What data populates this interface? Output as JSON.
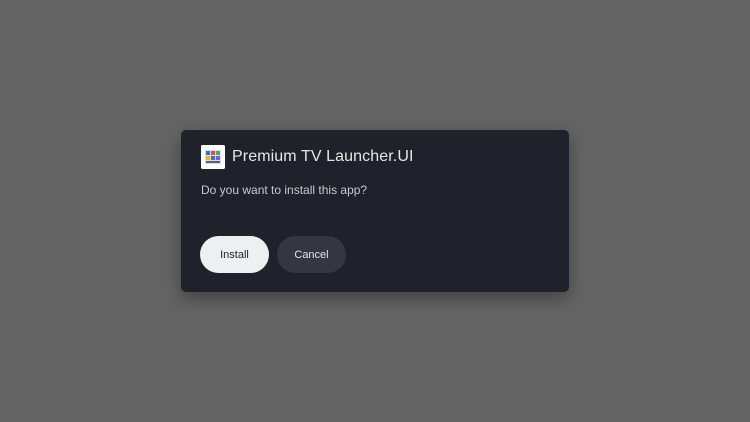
{
  "dialog": {
    "app_icon": "launcher-app-icon",
    "title": "Premium TV Launcher.UI",
    "message": "Do you want to install this app?",
    "install_label": "Install",
    "cancel_label": "Cancel"
  },
  "colors": {
    "backdrop": "#646464",
    "dialog_bg": "#1f222a",
    "install_bg": "#eeeff1",
    "cancel_bg": "#353740"
  }
}
